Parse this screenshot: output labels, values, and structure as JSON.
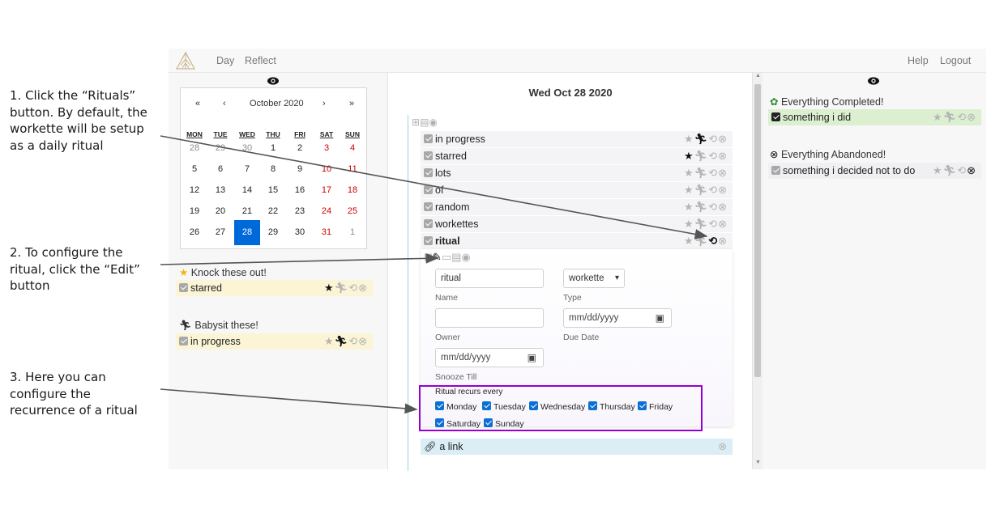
{
  "annotations": [
    {
      "text": "1. Click the “Rituals” button. By default, the workette will be setup as a daily ritual"
    },
    {
      "text": "2. To configure the ritual, click the “Edit” button"
    },
    {
      "text": "3. Here you can configure the recurrence of a ritual"
    }
  ],
  "nav": {
    "day": "Day",
    "reflect": "Reflect",
    "help": "Help",
    "logout": "Logout"
  },
  "calendar": {
    "prev_year": "«",
    "prev_month": "‹",
    "month_label": "October 2020",
    "next_month": "›",
    "next_year": "»",
    "weekdays": [
      "MON",
      "TUE",
      "WED",
      "THU",
      "FRI",
      "SAT",
      "SUN"
    ],
    "weeks": [
      [
        "28",
        "29",
        "30",
        "1",
        "2",
        "3",
        "4"
      ],
      [
        "5",
        "6",
        "7",
        "8",
        "9",
        "10",
        "11"
      ],
      [
        "12",
        "13",
        "14",
        "15",
        "16",
        "17",
        "18"
      ],
      [
        "19",
        "20",
        "21",
        "22",
        "23",
        "24",
        "25"
      ],
      [
        "26",
        "27",
        "28",
        "29",
        "30",
        "31",
        "1"
      ]
    ]
  },
  "left": {
    "starred_title": "Knock these out!",
    "starred_item": "starred",
    "babysit_title": "Babysit these!",
    "babysit_item": "in progress"
  },
  "middle": {
    "date": "Wed Oct 28 2020",
    "items": [
      "in progress",
      "starred",
      "lots",
      "of",
      "random",
      "workettes"
    ],
    "ritual_item": "ritual",
    "form": {
      "name_value": "ritual",
      "name_label": "Name",
      "type_value": "workette",
      "type_label": "Type",
      "owner_value": "",
      "owner_label": "Owner",
      "due_placeholder": "mm/dd/yyyy",
      "due_label": "Due Date",
      "snooze_placeholder": "mm/dd/yyyy",
      "snooze_label": "Snooze Till",
      "recurs_label": "Ritual recurs every",
      "days": [
        "Monday",
        "Tuesday",
        "Wednesday",
        "Thursday",
        "Friday",
        "Saturday",
        "Sunday"
      ]
    },
    "link_item": "a link"
  },
  "right": {
    "completed_title": "Everything Completed!",
    "completed_item": "something i did",
    "abandoned_title": "Everything Abandoned!",
    "abandoned_item": "something i decided not to do"
  },
  "colors": {
    "accent": "#0069d9",
    "highlight": "#9400d3",
    "starred_bg": "#fbf5d6",
    "completed_bg": "#dcefd0",
    "link_bg": "#dbeef6"
  },
  "icons": [
    "eye-icon",
    "star-icon",
    "running-icon",
    "repeat-icon",
    "close-circle-icon",
    "pencil-icon",
    "folder-icon",
    "note-icon",
    "plus-square-icon",
    "link-icon",
    "frog-icon",
    "calendar-icon"
  ]
}
